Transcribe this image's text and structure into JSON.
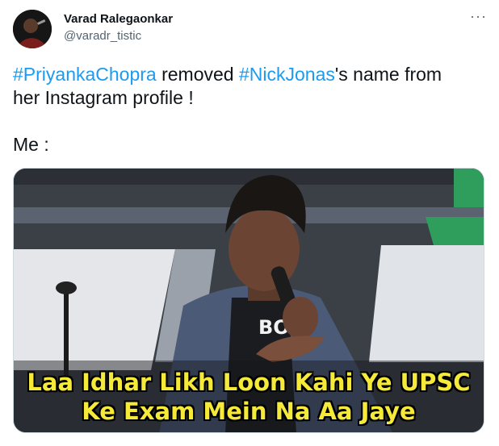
{
  "author": {
    "name": "Varad Ralegaonkar",
    "handle": "@varadr_tistic"
  },
  "more_icon": "more-horizontal-icon",
  "tweet": {
    "hashtag1": "#PriyankaChopra",
    "text1": " removed ",
    "hashtag2": "#NickJonas",
    "text2": "'s name from",
    "line2": "her Instagram profile !",
    "line3": "Me :"
  },
  "media": {
    "caption_line1": "Laa Idhar Likh Loon Kahi Ye UPSC",
    "caption_line2": "Ke Exam Mein Na Aa Jaye",
    "shirt_text": "BO"
  },
  "colors": {
    "hashtag": "#1d9bf0",
    "caption": "#f5ea3a",
    "handle": "#536471"
  }
}
